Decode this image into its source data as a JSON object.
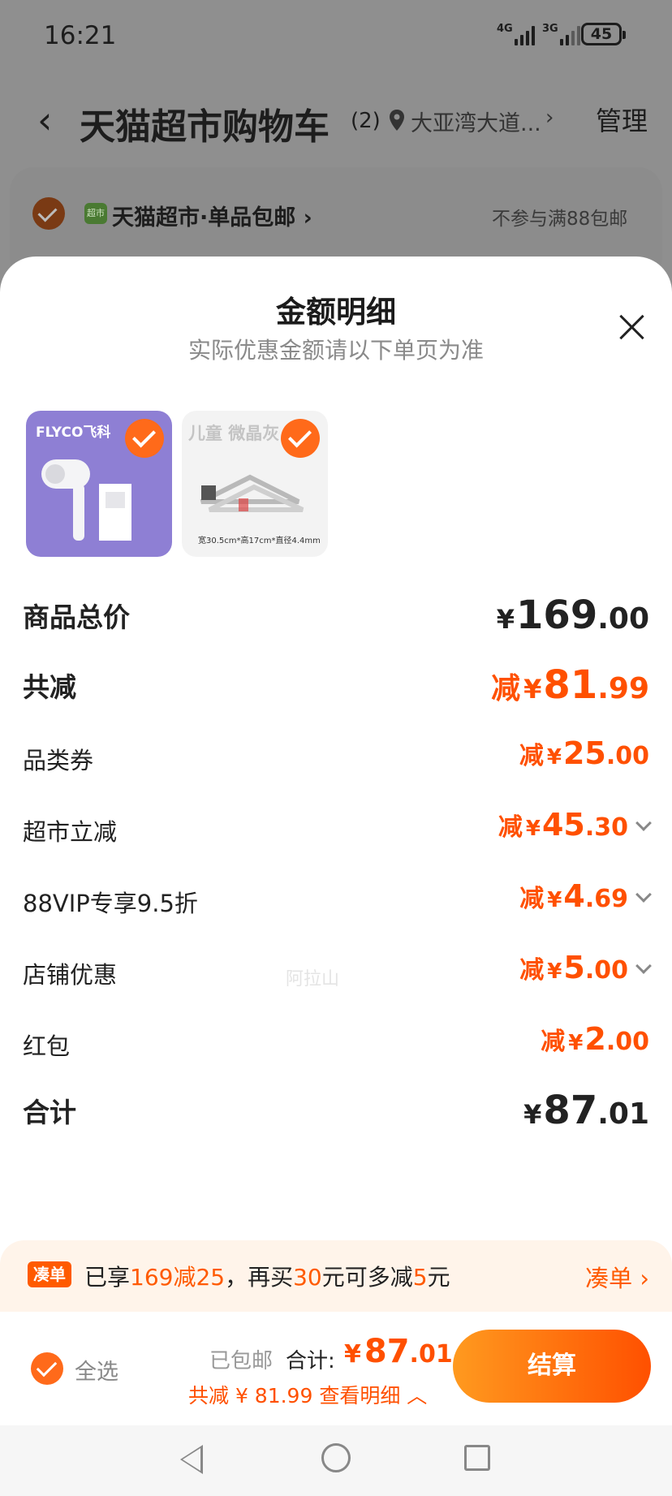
{
  "status": {
    "time": "16:21",
    "net1": "4G",
    "net2": "3G",
    "battery": "45"
  },
  "header": {
    "back_icon": "chevron-left-icon",
    "title": "天猫超市购物车",
    "count": "(2)",
    "address": "大亚湾大道...",
    "manage": "管理"
  },
  "store": {
    "name": "天猫超市·单品包邮 ›",
    "note": "不参与满88包邮",
    "icon_text": "超市"
  },
  "sheet": {
    "title": "金额明细",
    "subtitle": "实际优惠金额请以下单页为准",
    "products": [
      {
        "brand": "FLYCO飞科",
        "checked": true
      },
      {
        "title": "儿童 微晶灰",
        "dims": "宽30.5cm*高17cm*直径4.4mm",
        "checked": true
      }
    ],
    "rows": [
      {
        "label": "商品总价",
        "prefix": "",
        "yen": "¥",
        "int": "169",
        "dec": ".00"
      },
      {
        "label": "共减",
        "prefix": "减",
        "yen": "¥",
        "int": "81",
        "dec": ".99"
      },
      {
        "label": "品类券",
        "prefix": "减",
        "yen": "¥",
        "int": "25",
        "dec": ".00"
      },
      {
        "label": "超市立减",
        "prefix": "减",
        "yen": "¥",
        "int": "45",
        "dec": ".30"
      },
      {
        "label": "88VIP专享9.5折",
        "prefix": "减",
        "yen": "¥",
        "int": "4",
        "dec": ".69"
      },
      {
        "label": "店铺优惠",
        "prefix": "减",
        "yen": "¥",
        "int": "5",
        "dec": ".00"
      },
      {
        "label": "红包",
        "prefix": "减",
        "yen": "¥",
        "int": "2",
        "dec": ".00"
      },
      {
        "label": "合计",
        "prefix": "",
        "yen": "¥",
        "int": "87",
        "dec": ".01"
      }
    ],
    "watermark": "阿拉山"
  },
  "promo": {
    "tag": "凑单",
    "t1": "已享",
    "t2": "169减25",
    "t3": "，再买",
    "t4": "30",
    "t5": "元可多减",
    "t6": "5",
    "t7": "元",
    "link": "凑单 ›"
  },
  "bottom": {
    "select_all": "全选",
    "shipped": "已包邮",
    "total_label": "合计:",
    "total_yen": "¥",
    "total_int": "87",
    "total_dec": ".01",
    "savings": "共减 ¥ 81.99  查看明细 ︿",
    "checkout": "结算"
  },
  "colors": {
    "accent": "#ff5000",
    "overlay": "#8f8f8f"
  }
}
